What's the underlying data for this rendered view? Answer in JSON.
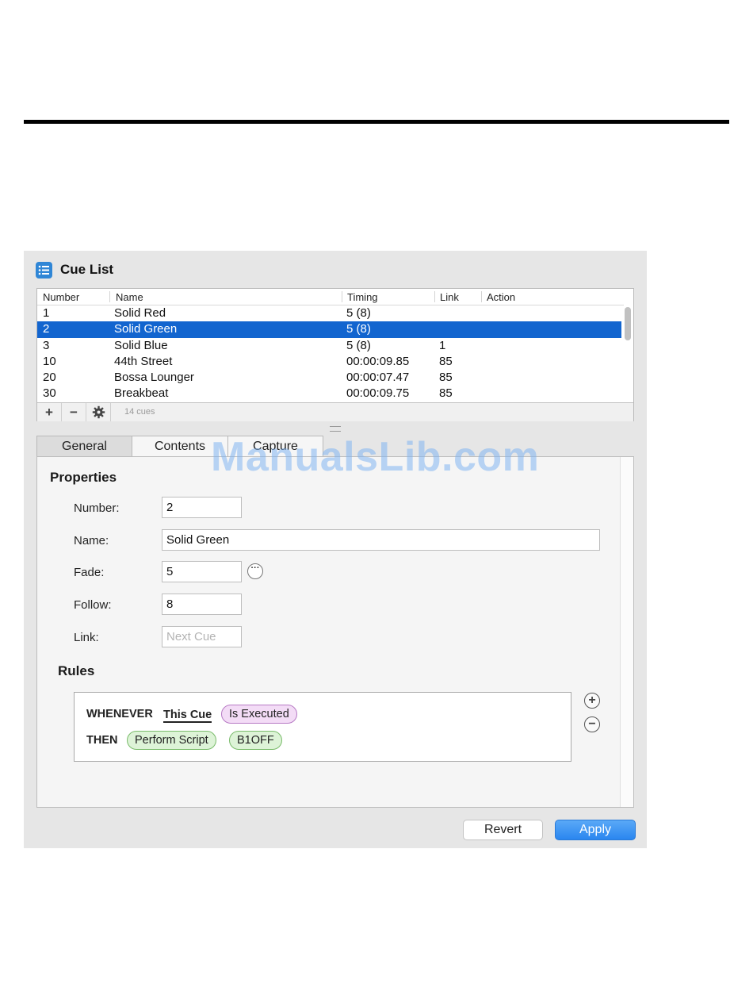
{
  "panel": {
    "title": "Cue List",
    "icon": "list-icon"
  },
  "table": {
    "headers": {
      "number": "Number",
      "name": "Name",
      "timing": "Timing",
      "link": "Link",
      "action": "Action"
    },
    "rows": [
      {
        "number": "1",
        "name": "Solid Red",
        "timing": "5 (8)",
        "link": ""
      },
      {
        "number": "2",
        "name": "Solid Green",
        "timing": "5 (8)",
        "link": "",
        "selected": true
      },
      {
        "number": "3",
        "name": "Solid Blue",
        "timing": "5 (8)",
        "link": "1"
      },
      {
        "number": "10",
        "name": "44th Street",
        "timing": "00:00:09.85",
        "link": "85"
      },
      {
        "number": "20",
        "name": "Bossa Lounger",
        "timing": "00:00:07.47",
        "link": "85"
      },
      {
        "number": "30",
        "name": "Breakbeat",
        "timing": "00:00:09.75",
        "link": "85"
      }
    ],
    "footer": {
      "add": "+",
      "remove": "−",
      "settings": "gear-icon",
      "count": "14 cues"
    }
  },
  "tabs": {
    "general": "General",
    "contents": "Contents",
    "capture": "Capture"
  },
  "properties": {
    "heading": "Properties",
    "number_label": "Number:",
    "number_value": "2",
    "name_label": "Name:",
    "name_value": "Solid Green",
    "fade_label": "Fade:",
    "fade_value": "5",
    "follow_label": "Follow:",
    "follow_value": "8",
    "link_label": "Link:",
    "link_placeholder": "Next Cue"
  },
  "rules": {
    "heading": "Rules",
    "whenever": "WHENEVER",
    "subject": "This Cue",
    "condition": "Is Executed",
    "then": "THEN",
    "action": "Perform Script",
    "script": "B1OFF",
    "add": "+",
    "remove": "−"
  },
  "buttons": {
    "revert": "Revert",
    "apply": "Apply"
  },
  "watermark": "ManualsLib.com",
  "colors": {
    "selection": "#1265cf",
    "apply": "#2a86ef",
    "condition_pill": "#f3dcf6",
    "action_pill": "#ddf3d7"
  }
}
